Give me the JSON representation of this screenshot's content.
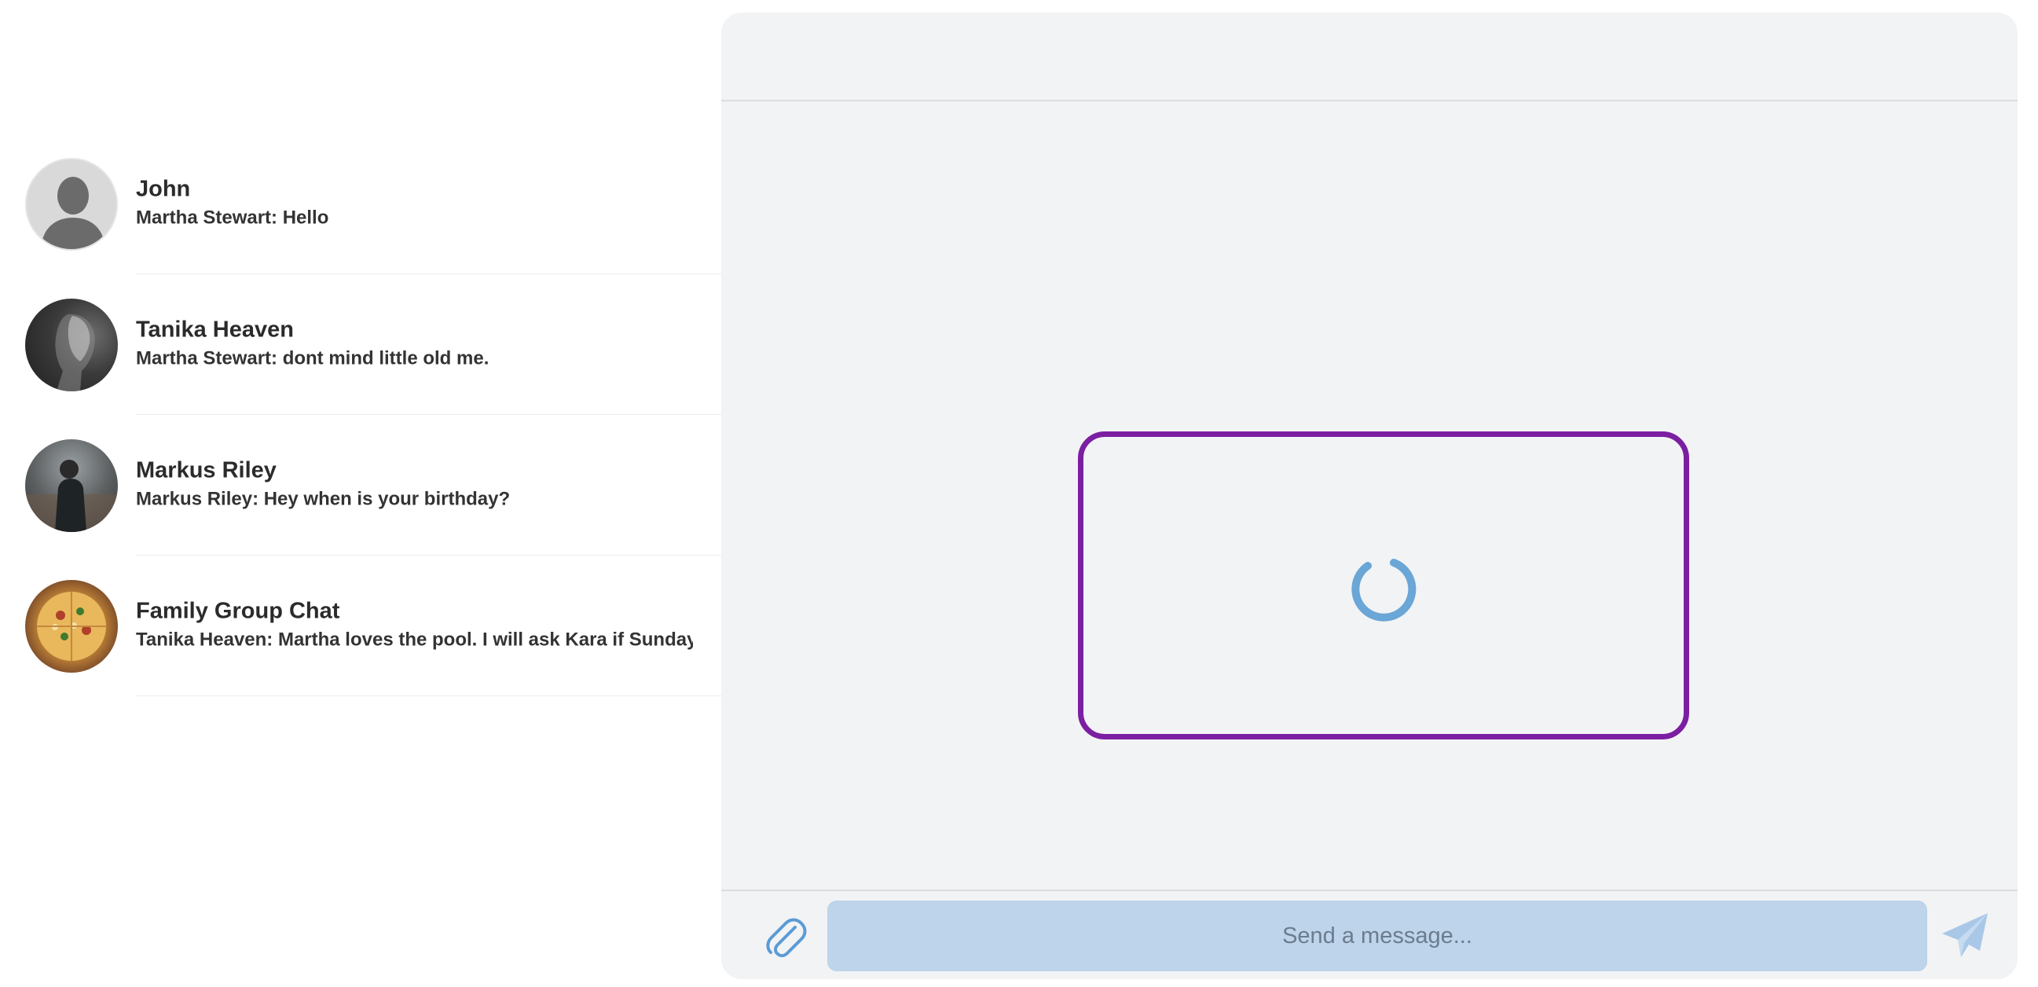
{
  "conversations": [
    {
      "name": "John",
      "preview": "Martha Stewart: Hello",
      "avatar": "default-person-icon"
    },
    {
      "name": "Tanika Heaven",
      "preview": "Martha Stewart: dont mind little old me.",
      "avatar": "profile-photo"
    },
    {
      "name": "Markus Riley",
      "preview": "Markus Riley: Hey when is your birthday?",
      "avatar": "profile-photo"
    },
    {
      "name": "Family Group Chat",
      "preview": "Tanika Heaven: Martha loves the pool. I will ask Kara if Sunday works",
      "avatar": "pizza-photo"
    }
  ],
  "chat": {
    "state": "loading",
    "composer": {
      "placeholder": "Send a message...",
      "attach_icon": "paperclip-icon",
      "send_icon": "paper-plane-icon"
    }
  },
  "colors": {
    "panel_bg": "#f2f3f5",
    "loading_border": "#7b1fa2",
    "spinner": "#6aa6d6",
    "input_bg": "#bdd4ea",
    "icon": "#5b9bd5"
  }
}
